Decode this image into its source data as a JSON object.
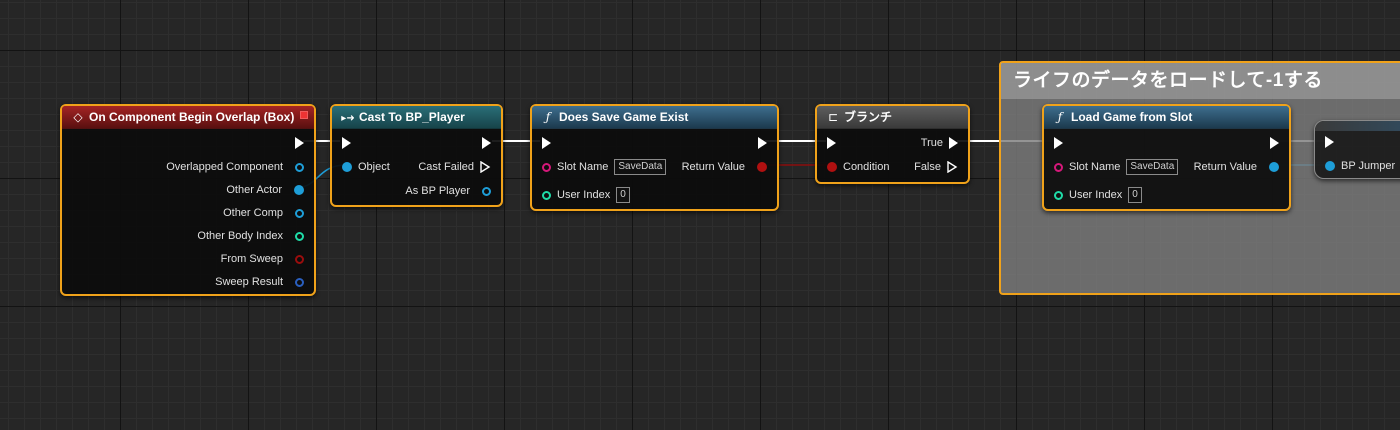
{
  "colors": {
    "selection_outline": "#f0a21a",
    "exec_wire": "#ffffff",
    "object_pin": "#1e9ed8",
    "string_pin": "#d6187a",
    "int_pin": "#1fdca8",
    "bool_pin": "#9a0d0d",
    "struct_pin": "#2a5fbf",
    "event_title": "#a42424",
    "cast_title": "#2a6e78",
    "function_title": "#3e6e8e",
    "branch_title": "#5e5e5e"
  },
  "comment": {
    "title": "ライフのデータをロードして-1する"
  },
  "event_node": {
    "title": "On Component Begin Overlap (Box)",
    "icon": "event-diamond-icon",
    "outputs": [
      "Overlapped Component",
      "Other Actor",
      "Other Comp",
      "Other Body Index",
      "From Sweep",
      "Sweep Result"
    ]
  },
  "cast_node": {
    "title": "Cast To BP_Player",
    "icon": "cast-arrow-icon",
    "input": "Object",
    "outputs": [
      "Cast Failed",
      "As BP Player"
    ]
  },
  "does_save_node": {
    "title": "Does Save Game Exist",
    "icon": "function-icon",
    "icon_glyph": "ƒ",
    "inputs": [
      {
        "label": "Slot Name",
        "value": "SaveData"
      },
      {
        "label": "User Index",
        "value": "0"
      }
    ],
    "output": "Return Value"
  },
  "branch_node": {
    "title": "ブランチ",
    "icon": "branch-icon",
    "input": "Condition",
    "outputs": [
      "True",
      "False"
    ]
  },
  "load_node": {
    "title": "Load Game from Slot",
    "icon": "function-icon",
    "icon_glyph": "ƒ",
    "inputs": [
      {
        "label": "Slot Name",
        "value": "SaveData"
      },
      {
        "label": "User Index",
        "value": "0"
      }
    ],
    "output": "Return Value"
  },
  "partial_node": {
    "input": "BP Jumper"
  }
}
